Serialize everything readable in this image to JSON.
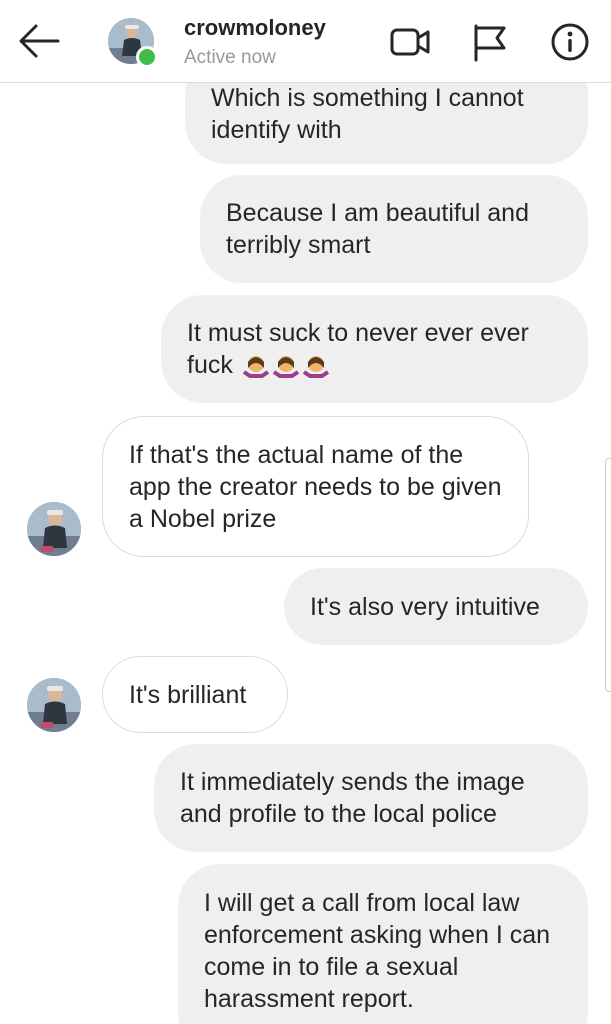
{
  "header": {
    "username": "crowmoloney",
    "status": "Active now",
    "back_icon": "arrow-left-icon",
    "video_icon": "video-camera-icon",
    "flag_icon": "flag-icon",
    "info_icon": "info-icon"
  },
  "messages": [
    {
      "direction": "outgoing",
      "text": "Which is something I cannot identify with"
    },
    {
      "direction": "outgoing",
      "text": "Because I am beautiful and terribly smart"
    },
    {
      "direction": "outgoing",
      "text": "It must suck to never ever ever fuck",
      "emoji": "woman-shrugging-emoji x3"
    },
    {
      "direction": "incoming",
      "text": "If that's the actual name of the app the creator needs to be given a Nobel prize"
    },
    {
      "direction": "outgoing",
      "text": "It's also very intuitive"
    },
    {
      "direction": "incoming",
      "text": "It's brilliant"
    },
    {
      "direction": "outgoing",
      "text": "It immediately sends the image and profile to the local police"
    },
    {
      "direction": "outgoing",
      "text": "I will get a call from local law enforcement asking when I can come in to file a sexual harassment report."
    }
  ],
  "colors": {
    "outgoing_bubble": "#efefef",
    "incoming_border": "#dbdbdb",
    "online": "#3fbf4a",
    "text": "#262626",
    "muted": "#999999"
  }
}
